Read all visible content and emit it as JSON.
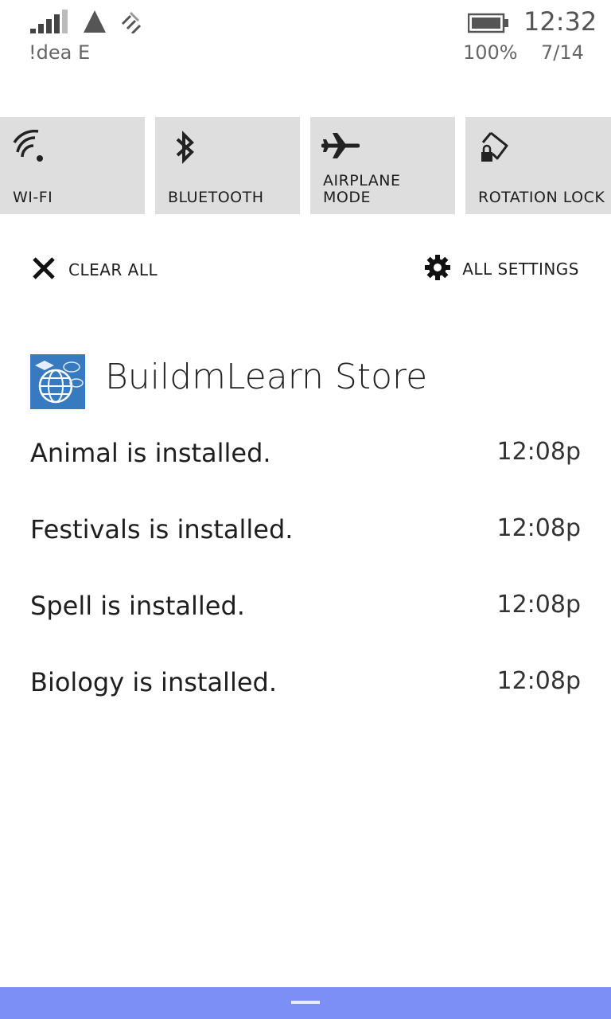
{
  "status_bar": {
    "carrier": "!dea E",
    "time": "12:32",
    "battery_percent": "100%",
    "date": "7/14",
    "signal_bars": 5,
    "icons": [
      "signal-icon",
      "network-warning-icon",
      "wifi-sense-icon",
      "battery-icon"
    ]
  },
  "quick_actions": [
    {
      "label": "WI-FI",
      "icon": "wifi-icon"
    },
    {
      "label": "BLUETOOTH",
      "icon": "bluetooth-icon"
    },
    {
      "label_line1": "AIRPLANE",
      "label_line2": "MODE",
      "icon": "airplane-icon"
    },
    {
      "label": "ROTATION LOCK",
      "icon": "rotation-lock-icon"
    }
  ],
  "actions": {
    "clear_all": "CLEAR ALL",
    "all_settings": "ALL SETTINGS"
  },
  "notification_group": {
    "app_name": "BuildmLearn Store",
    "items": [
      {
        "message": "Animal is installed.",
        "time": "12:08p"
      },
      {
        "message": "Festivals is installed.",
        "time": "12:08p"
      },
      {
        "message": "Spell is installed.",
        "time": "12:08p"
      },
      {
        "message": "Biology is installed.",
        "time": "12:08p"
      }
    ]
  },
  "colors": {
    "tile_bg": "#dedede",
    "bottom_bar": "#7b8ff7"
  }
}
